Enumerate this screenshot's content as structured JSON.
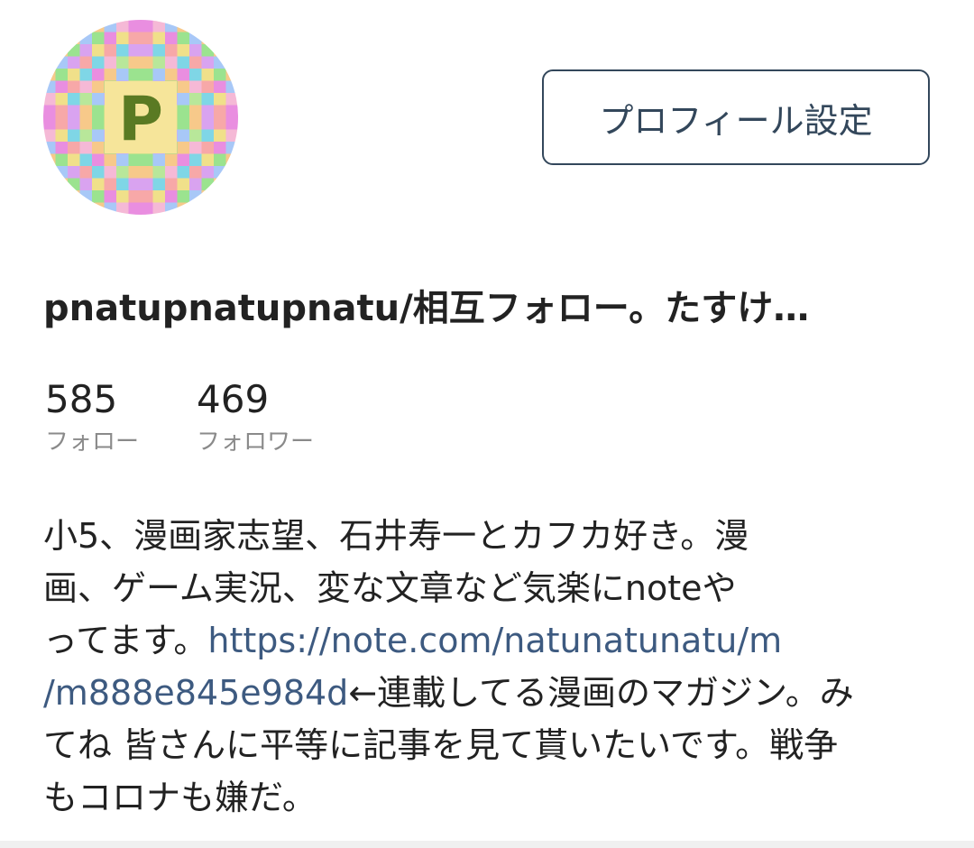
{
  "profile": {
    "settings_button_label": "プロフィール設定",
    "display_name": "pnatupnatupnatu/相互フォロー。たすけ…",
    "avatar_letter": "P",
    "stats": {
      "following_count": "585",
      "following_label": "フォロー",
      "followers_count": "469",
      "followers_label": "フォロワー"
    },
    "bio": {
      "line1": "小5、漫画家志望、石井寿一とカフカ好き。漫",
      "line2": "画、ゲーム実況、変な文章など気楽にnoteや",
      "line3_text": "ってます。",
      "line3_link": "https://note.com/natunatunatu/m",
      "line4_link": "/m888e845e984d",
      "line4_text": "←連載してる漫画のマガジン。み",
      "line5": "てね 皆さんに平等に記事を見て貰いたいです。戦争",
      "line6": "もコロナも嫌だ。"
    }
  },
  "colors": {
    "accent": "#33475b",
    "link": "#3d5a80",
    "muted": "#8a8a8a",
    "text": "#222222"
  }
}
